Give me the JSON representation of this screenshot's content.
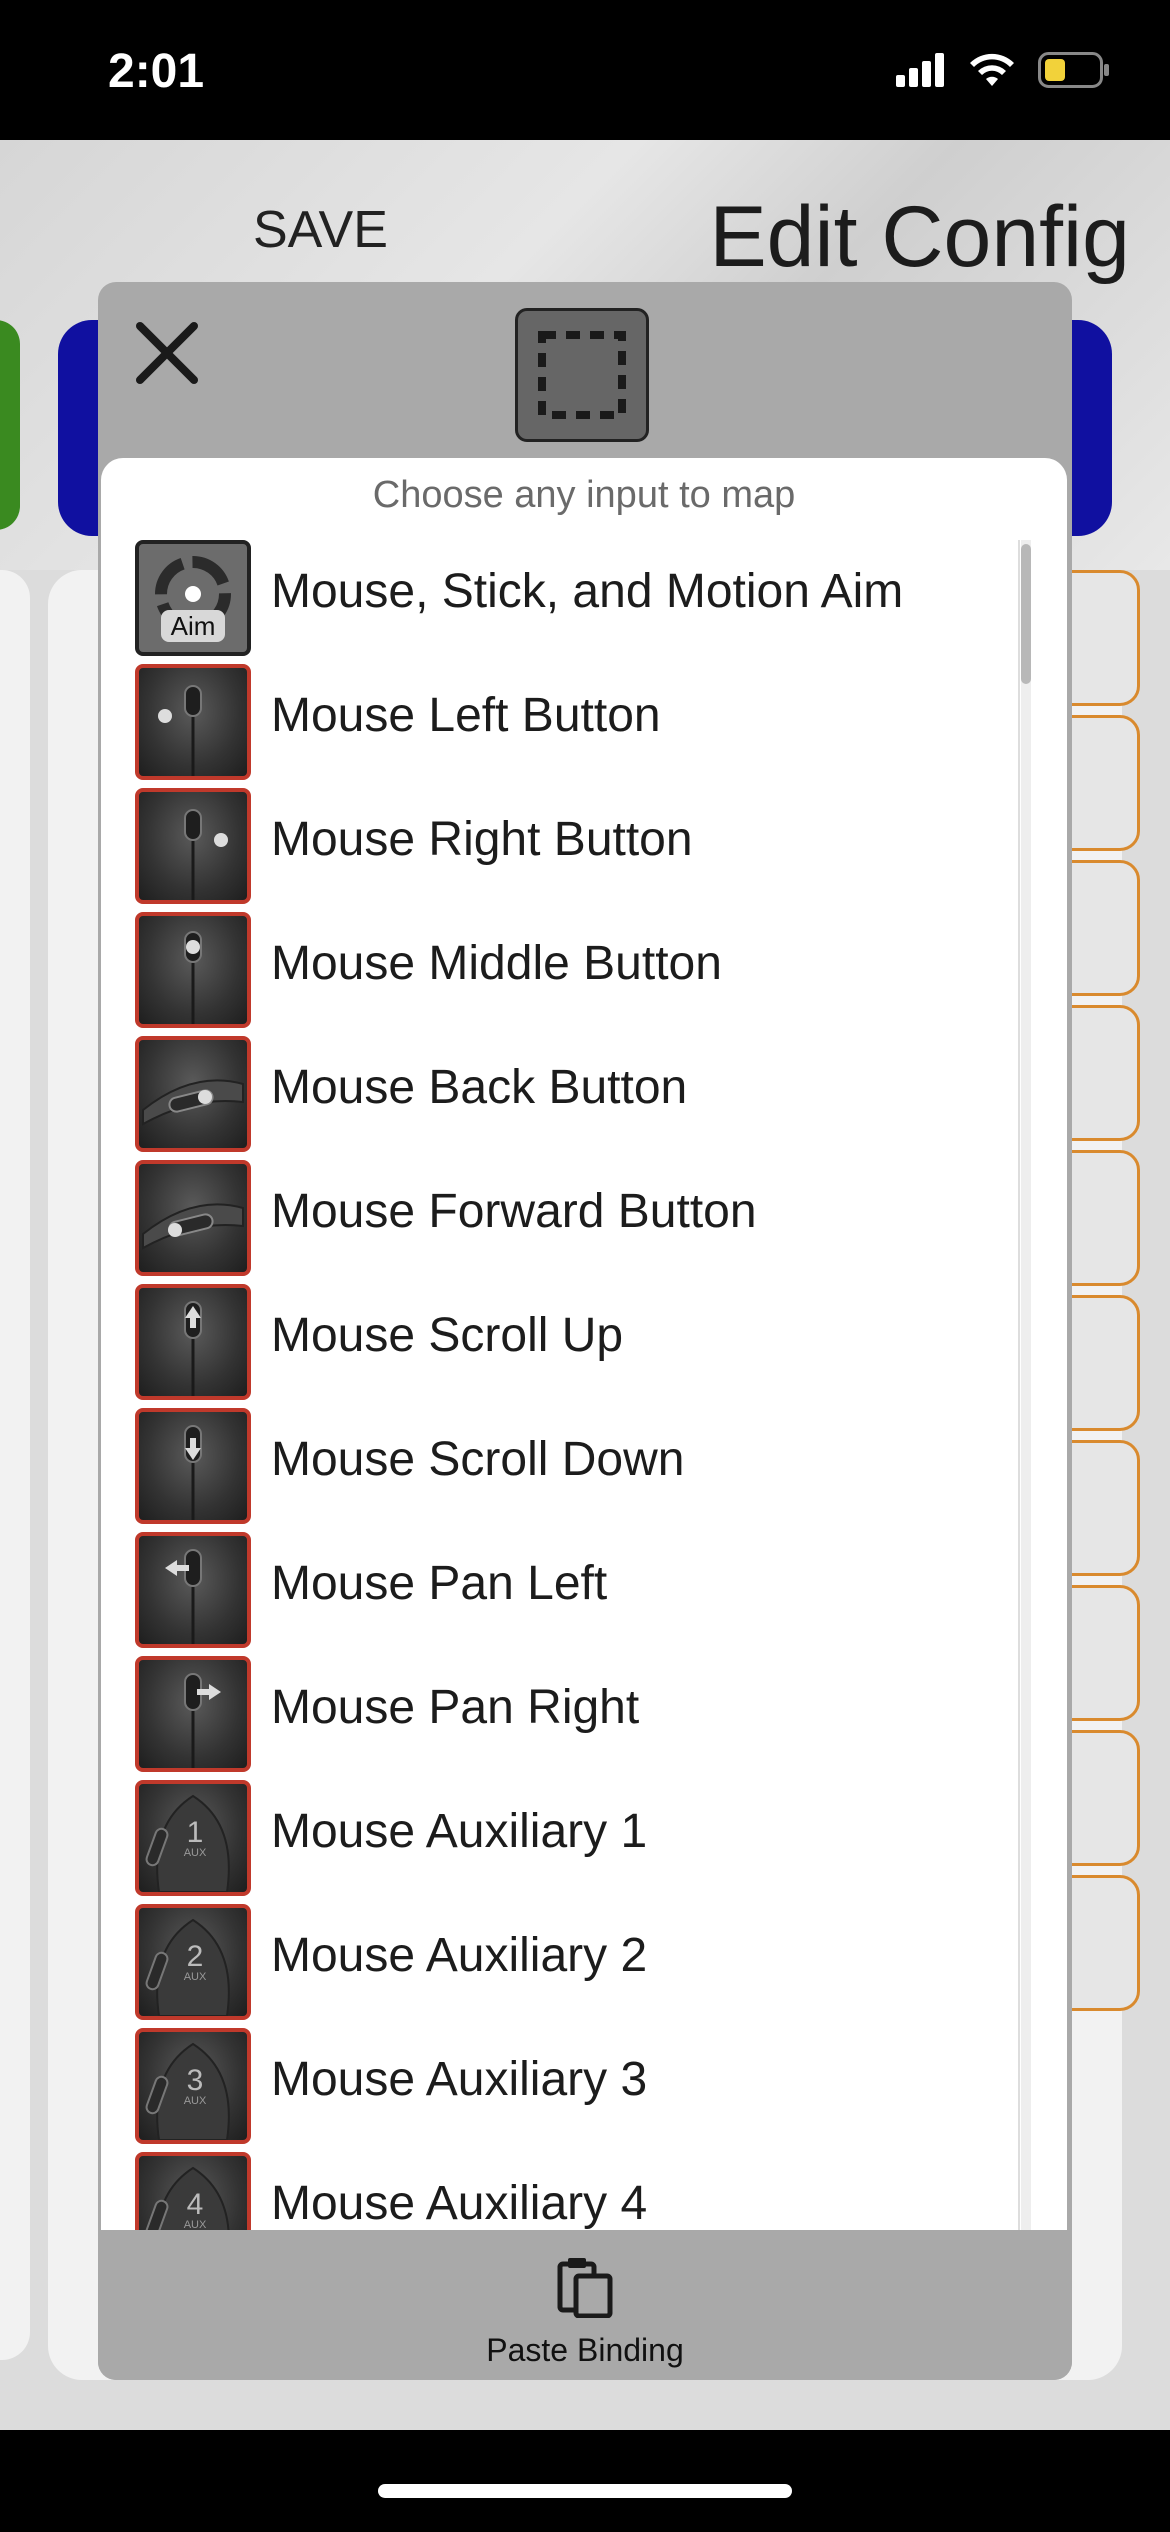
{
  "status_bar": {
    "time": "2:01"
  },
  "header": {
    "save_label": "SAVE",
    "title": "Edit Config"
  },
  "modal": {
    "prompt": "Choose any input to map",
    "items": [
      {
        "label": "Mouse, Stick, and Motion Aim",
        "icon": "aim-icon",
        "badge": "Aim"
      },
      {
        "label": "Mouse Left Button",
        "icon": "mouse-left-icon"
      },
      {
        "label": "Mouse Right Button",
        "icon": "mouse-right-icon"
      },
      {
        "label": "Mouse Middle Button",
        "icon": "mouse-middle-icon"
      },
      {
        "label": "Mouse Back Button",
        "icon": "mouse-back-icon"
      },
      {
        "label": "Mouse Forward Button",
        "icon": "mouse-forward-icon"
      },
      {
        "label": "Mouse Scroll Up",
        "icon": "mouse-scroll-up-icon"
      },
      {
        "label": "Mouse Scroll Down",
        "icon": "mouse-scroll-down-icon"
      },
      {
        "label": "Mouse Pan Left",
        "icon": "mouse-pan-left-icon"
      },
      {
        "label": "Mouse Pan Right",
        "icon": "mouse-pan-right-icon"
      },
      {
        "label": "Mouse Auxiliary 1",
        "icon": "mouse-aux-icon",
        "badge": "1",
        "sub": "AUX"
      },
      {
        "label": "Mouse Auxiliary 2",
        "icon": "mouse-aux-icon",
        "badge": "2",
        "sub": "AUX"
      },
      {
        "label": "Mouse Auxiliary 3",
        "icon": "mouse-aux-icon",
        "badge": "3",
        "sub": "AUX"
      },
      {
        "label": "Mouse Auxiliary 4",
        "icon": "mouse-aux-icon",
        "badge": "4",
        "sub": "AUX"
      }
    ],
    "footer": {
      "paste_label": "Paste Binding"
    }
  },
  "colors": {
    "accent_blue": "#1010a0",
    "accent_green": "#3a8a20",
    "icon_border_red": "#c0392b",
    "row_border_orange": "#d98a2e"
  }
}
